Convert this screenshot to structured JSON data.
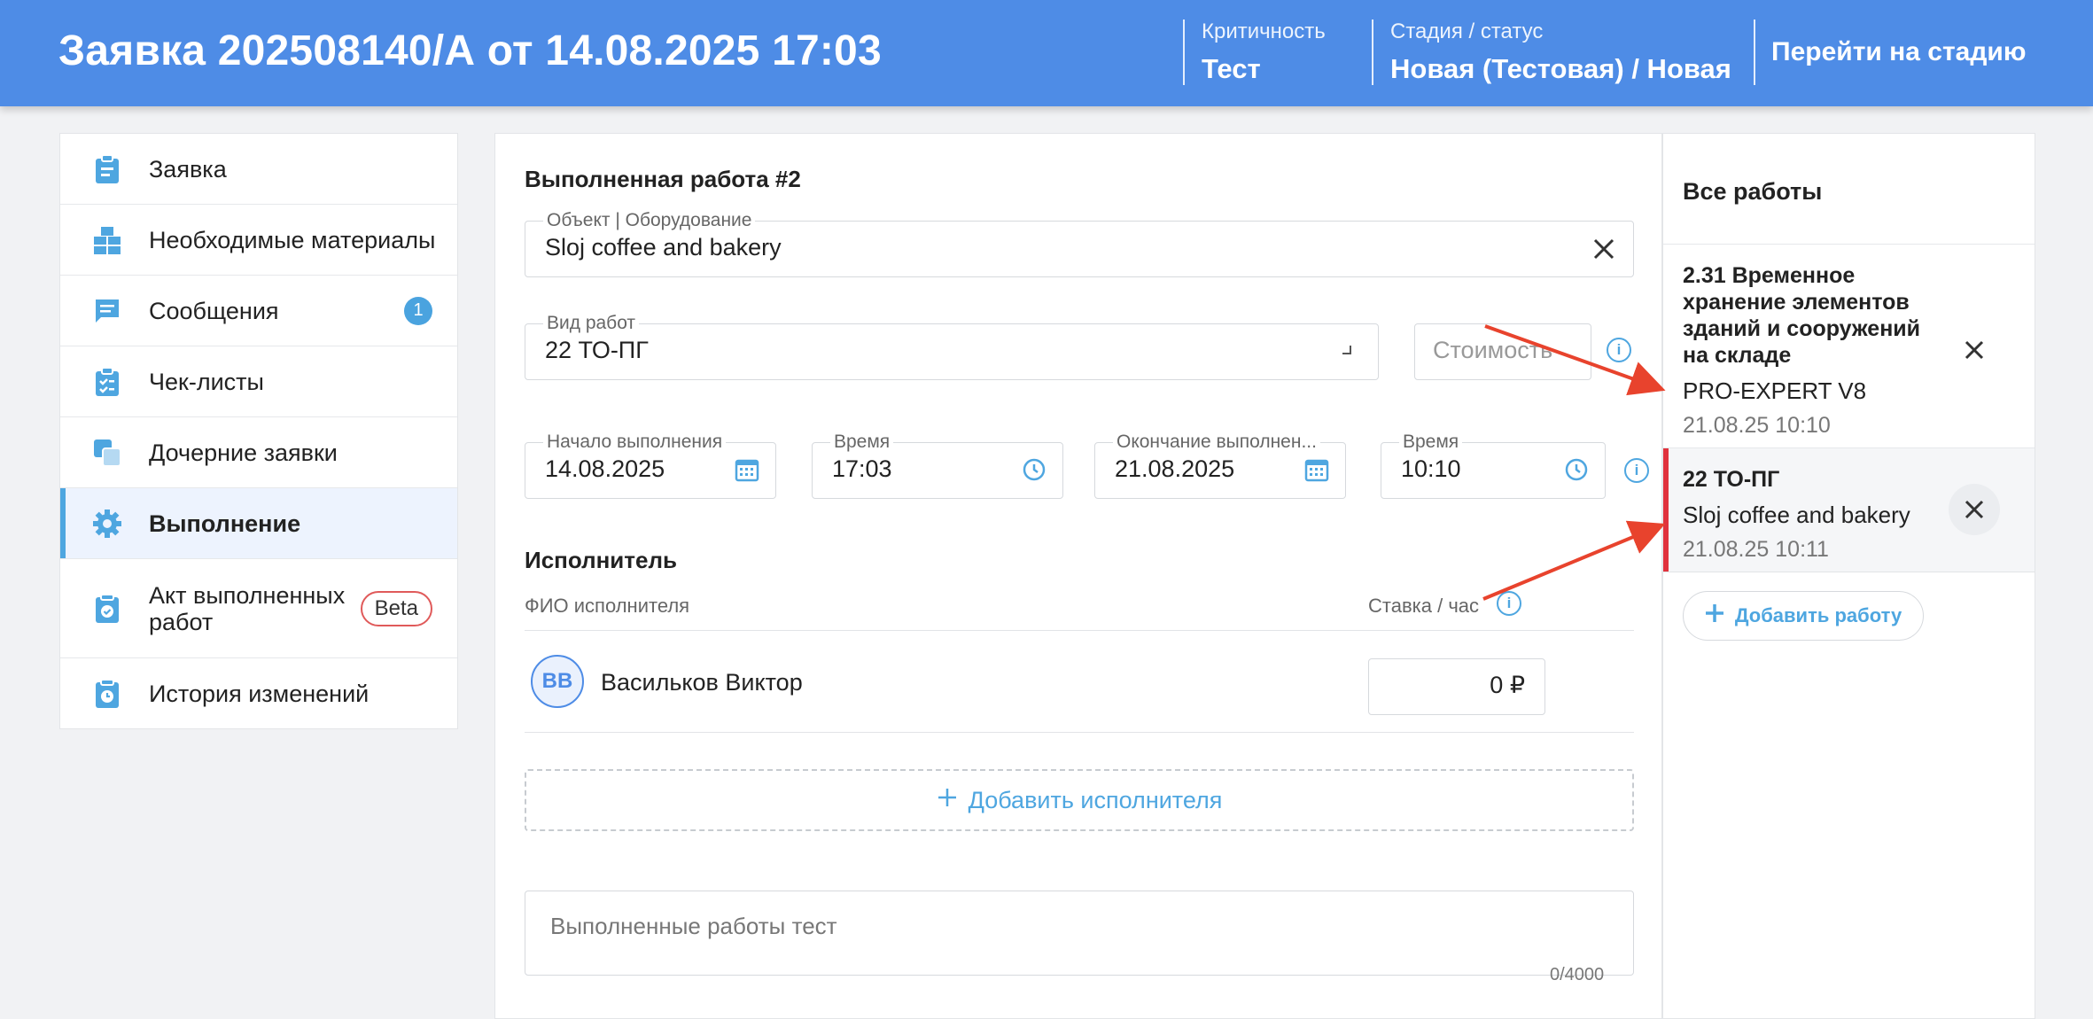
{
  "header": {
    "title": "Заявка 202508140/А от 14.08.2025 17:03",
    "criticality_label": "Критичность",
    "criticality_value": "Тест",
    "stage_label": "Стадия / статус",
    "stage_value": "Новая (Тестовая) / Новая",
    "goto_stage": "Перейти на стадию"
  },
  "sidebar": {
    "items": [
      {
        "label": "Заявка",
        "icon": "clipboard-icon"
      },
      {
        "label": "Необходимые материалы",
        "icon": "boxes-icon"
      },
      {
        "label": "Сообщения",
        "icon": "message-icon",
        "badge": "1"
      },
      {
        "label": "Чек-листы",
        "icon": "checklist-icon"
      },
      {
        "label": "Дочерние заявки",
        "icon": "child-requests-icon"
      },
      {
        "label": "Выполнение",
        "icon": "gear-icon",
        "active": true
      },
      {
        "label": "Акт выполненных работ",
        "icon": "act-icon",
        "badge": "Beta"
      },
      {
        "label": "История изменений",
        "icon": "history-icon"
      }
    ]
  },
  "main": {
    "title": "Выполненная работа #2",
    "object": {
      "label": "Объект | Оборудование",
      "value": "Sloj coffee and bakery"
    },
    "work_type": {
      "label": "Вид работ",
      "value": "22 ТО-ПГ"
    },
    "cost": {
      "placeholder": "Стоимость"
    },
    "start_date": {
      "label": "Начало выполнения",
      "value": "14.08.2025"
    },
    "start_time": {
      "label": "Время",
      "value": "17:03"
    },
    "end_date": {
      "label": "Окончание выполнен...",
      "value": "21.08.2025"
    },
    "end_time": {
      "label": "Время",
      "value": "10:10"
    },
    "performer_section": "Исполнитель",
    "col_name": "ФИО исполнителя",
    "col_rate": "Ставка / час",
    "performer": {
      "initials": "ВВ",
      "name": "Васильков Виктор",
      "rate": "0 ₽"
    },
    "add_performer": "Добавить исполнителя",
    "description": {
      "placeholder": "Выполненные работы тест",
      "counter": "0/4000"
    }
  },
  "right": {
    "title": "Все работы",
    "works": [
      {
        "title": "2.31 Временное хранение элементов зданий и сооружений на складе",
        "object": "PRO-EXPERT V8",
        "date": "21.08.25 10:10"
      },
      {
        "title": "22 ТО-ПГ",
        "object": "Sloj coffee and bakery",
        "date": "21.08.25 10:11",
        "selected": true
      }
    ],
    "add_work": "Добавить работу"
  },
  "colors": {
    "header": "#4e8ce6",
    "accent": "#4ea6e0",
    "selected_marker": "#e0323d",
    "annotation_arrow": "#e8432d"
  }
}
